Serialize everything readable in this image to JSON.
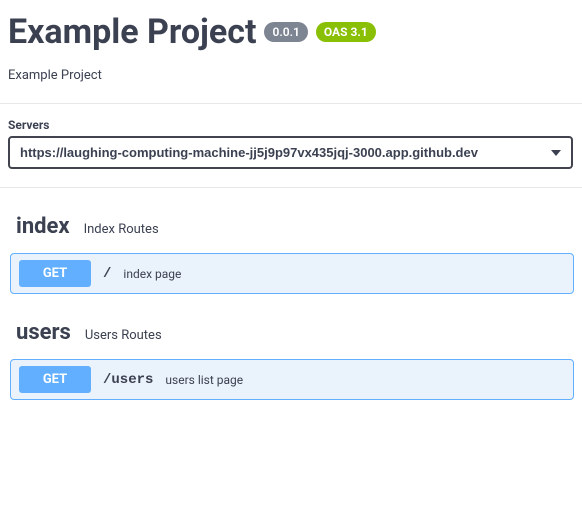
{
  "header": {
    "title": "Example Project",
    "version": "0.0.1",
    "oas_badge": "OAS 3.1",
    "description": "Example Project"
  },
  "servers": {
    "label": "Servers",
    "selected": "https://laughing-computing-machine-jj5j9p97vx435jqj-3000.app.github.dev"
  },
  "tags": [
    {
      "name": "index",
      "description": "Index Routes",
      "operations": [
        {
          "method": "GET",
          "path": "/",
          "summary": "index page"
        }
      ]
    },
    {
      "name": "users",
      "description": "Users Routes",
      "operations": [
        {
          "method": "GET",
          "path": "/users",
          "summary": "users list page"
        }
      ]
    }
  ]
}
